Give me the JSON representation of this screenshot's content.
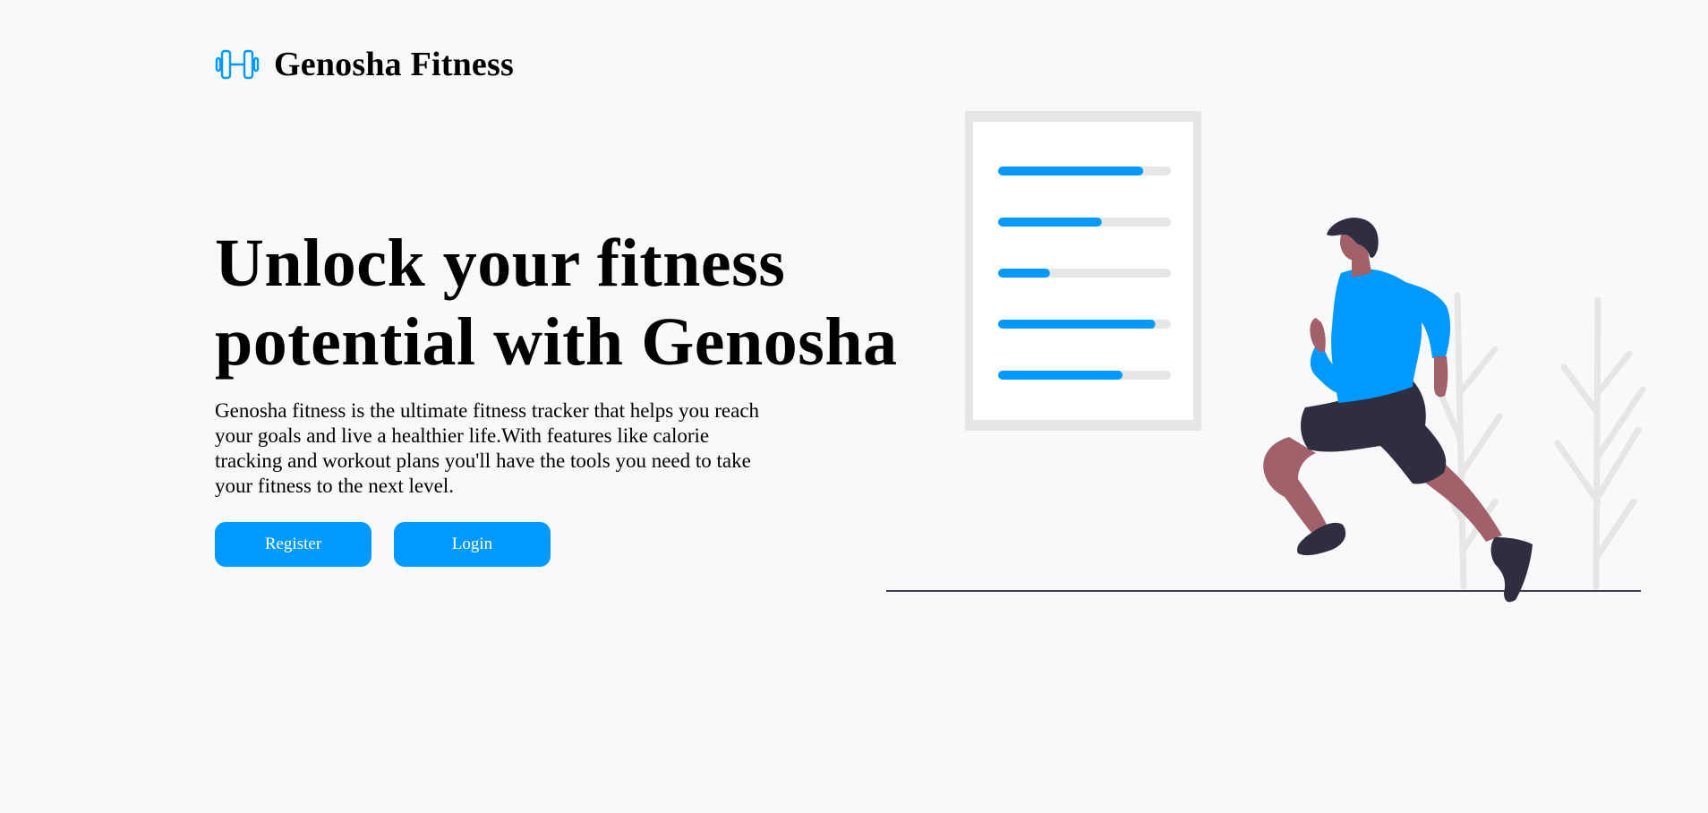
{
  "brand": {
    "name": "Genosha Fitness",
    "icon": "dumbbell-icon"
  },
  "hero": {
    "title_line1": "Unlock your fitness",
    "title_line2": "potential with Genosha",
    "description": "Genosha fitness is the ultimate fitness tracker that helps you reach your goals and live a healthier life.With features like calorie tracking and workout plans you'll have the tools you need to take your fitness to the next level."
  },
  "actions": {
    "register_label": "Register",
    "login_label": "Login"
  },
  "illustration": {
    "name": "runner-illustration",
    "progress_levels": [
      0.84,
      0.6,
      0.3,
      0.91,
      0.72
    ]
  },
  "colors": {
    "accent": "#0099ff",
    "background": "#f8f9fa",
    "track": "#e6e6e6",
    "dark": "#2f2e41",
    "skin": "#a0616a"
  }
}
